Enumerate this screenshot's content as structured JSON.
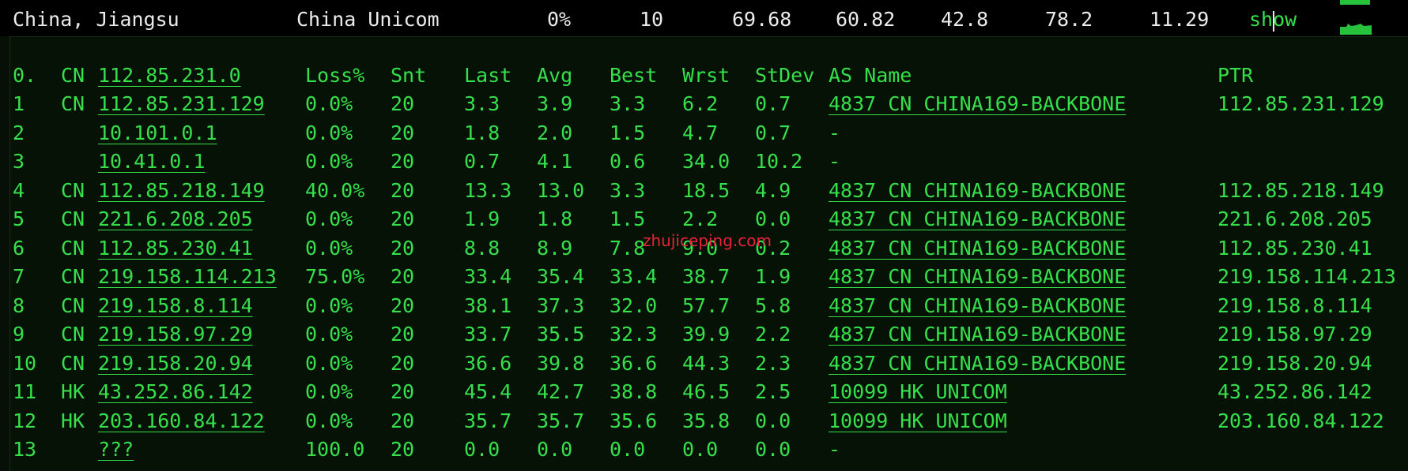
{
  "header": {
    "location": "China, Jiangsu",
    "isp": "China Unicom",
    "loss": "0%",
    "sent": "10",
    "last": "69.68",
    "avg": "60.82",
    "best": "42.8",
    "worst": "78.2",
    "stdev": "11.29",
    "show_label": "show"
  },
  "table": {
    "columns": {
      "index": "0.",
      "cc": "CN",
      "host": "112.85.231.0",
      "loss": "Loss%",
      "snt": "Snt",
      "last": "Last",
      "avg": "Avg",
      "best": "Best",
      "wrst": "Wrst",
      "stdev": "StDev",
      "as": "AS Name",
      "ptr": "PTR"
    },
    "rows": [
      {
        "hop": "1",
        "cc": "CN",
        "host": "112.85.231.129",
        "loss": "0.0%",
        "snt": "20",
        "last": "3.3",
        "avg": "3.9",
        "best": "3.3",
        "wrst": "6.2",
        "stdev": "0.7",
        "as": "4837  CN CHINA169-BACKBONE",
        "ptr": "112.85.231.129"
      },
      {
        "hop": "2",
        "cc": "",
        "host": "10.101.0.1",
        "loss": "0.0%",
        "snt": "20",
        "last": "1.8",
        "avg": "2.0",
        "best": "1.5",
        "wrst": "4.7",
        "stdev": "0.7",
        "as": "-",
        "ptr": ""
      },
      {
        "hop": "3",
        "cc": "",
        "host": "10.41.0.1",
        "loss": "0.0%",
        "snt": "20",
        "last": "0.7",
        "avg": "4.1",
        "best": "0.6",
        "wrst": "34.0",
        "stdev": "10.2",
        "as": "-",
        "ptr": ""
      },
      {
        "hop": "4",
        "cc": "CN",
        "host": "112.85.218.149",
        "loss": "40.0%",
        "snt": "20",
        "last": "13.3",
        "avg": "13.0",
        "best": "3.3",
        "wrst": "18.5",
        "stdev": "4.9",
        "as": "4837  CN CHINA169-BACKBONE",
        "ptr": "112.85.218.149"
      },
      {
        "hop": "5",
        "cc": "CN",
        "host": "221.6.208.205",
        "loss": "0.0%",
        "snt": "20",
        "last": "1.9",
        "avg": "1.8",
        "best": "1.5",
        "wrst": "2.2",
        "stdev": "0.0",
        "as": "4837  CN CHINA169-BACKBONE",
        "ptr": "221.6.208.205"
      },
      {
        "hop": "6",
        "cc": "CN",
        "host": "112.85.230.41",
        "loss": "0.0%",
        "snt": "20",
        "last": "8.8",
        "avg": "8.9",
        "best": "7.8",
        "wrst": "9.0",
        "stdev": "0.2",
        "as": "4837  CN CHINA169-BACKBONE",
        "ptr": "112.85.230.41"
      },
      {
        "hop": "7",
        "cc": "CN",
        "host": "219.158.114.213",
        "loss": "75.0%",
        "snt": "20",
        "last": "33.4",
        "avg": "35.4",
        "best": "33.4",
        "wrst": "38.7",
        "stdev": "1.9",
        "as": "4837  CN CHINA169-BACKBONE",
        "ptr": "219.158.114.213"
      },
      {
        "hop": "8",
        "cc": "CN",
        "host": "219.158.8.114",
        "loss": "0.0%",
        "snt": "20",
        "last": "38.1",
        "avg": "37.3",
        "best": "32.0",
        "wrst": "57.7",
        "stdev": "5.8",
        "as": "4837  CN CHINA169-BACKBONE",
        "ptr": "219.158.8.114"
      },
      {
        "hop": "9",
        "cc": "CN",
        "host": "219.158.97.29",
        "loss": "0.0%",
        "snt": "20",
        "last": "33.7",
        "avg": "35.5",
        "best": "32.3",
        "wrst": "39.9",
        "stdev": "2.2",
        "as": "4837  CN CHINA169-BACKBONE",
        "ptr": "219.158.97.29"
      },
      {
        "hop": "10",
        "cc": "CN",
        "host": "219.158.20.94",
        "loss": "0.0%",
        "snt": "20",
        "last": "36.6",
        "avg": "39.8",
        "best": "36.6",
        "wrst": "44.3",
        "stdev": "2.3",
        "as": "4837  CN CHINA169-BACKBONE",
        "ptr": "219.158.20.94"
      },
      {
        "hop": "11",
        "cc": "HK",
        "host": "43.252.86.142",
        "loss": "0.0%",
        "snt": "20",
        "last": "45.4",
        "avg": "42.7",
        "best": "38.8",
        "wrst": "46.5",
        "stdev": "2.5",
        "as": "10099 HK UNICOM",
        "ptr": "43.252.86.142"
      },
      {
        "hop": "12",
        "cc": "HK",
        "host": "203.160.84.122",
        "loss": "0.0%",
        "snt": "20",
        "last": "35.7",
        "avg": "35.7",
        "best": "35.6",
        "wrst": "35.8",
        "stdev": "0.0",
        "as": "10099 HK UNICOM",
        "ptr": "203.160.84.122"
      },
      {
        "hop": "13",
        "cc": "",
        "host": "???",
        "loss": "100.0",
        "snt": "20",
        "last": "0.0",
        "avg": "0.0",
        "best": "0.0",
        "wrst": "0.0",
        "stdev": "0.0",
        "as": "-",
        "ptr": ""
      }
    ]
  },
  "watermark": "zhujiceping.com",
  "colors": {
    "terminal_green": "#35e04a",
    "background": "#071207",
    "header_background": "#000000",
    "watermark": "#e8223a"
  },
  "icons": [
    "sparkline-graph-icon"
  ]
}
